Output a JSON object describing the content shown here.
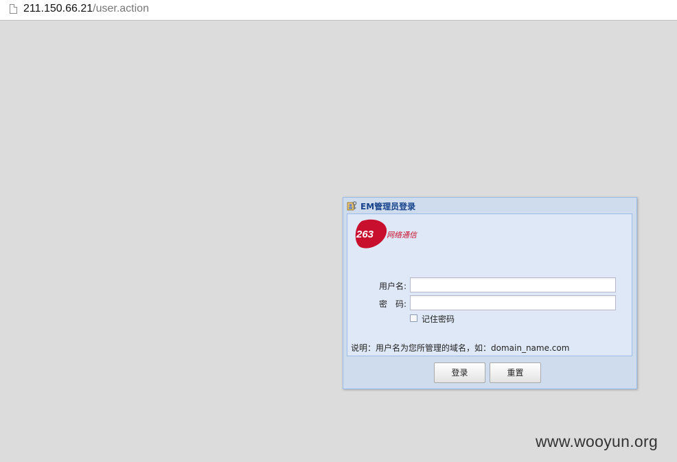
{
  "browser": {
    "url_host": "211.150.66.21",
    "url_path": "/user.action"
  },
  "dialog": {
    "title": "EM管理员登录",
    "logo_text": "网络通信",
    "logo_number": "263",
    "username_label": "用户名:",
    "password_label": "密　码:",
    "username_value": "",
    "password_value": "",
    "remember_label": "记住密码",
    "remember_checked": false,
    "note": "说明：用户名为您所管理的域名，如：domain_name.com",
    "login_button": "登录",
    "reset_button": "重置"
  },
  "watermark": "www.wooyun.org",
  "colors": {
    "background": "#dcdcdc",
    "dialog_frame": "#cfdcee",
    "panel": "#dfe8f6",
    "title_text": "#15428b",
    "logo_red": "#c8102e"
  },
  "icons": {
    "title": "user-key-icon",
    "tab": "page-icon"
  }
}
